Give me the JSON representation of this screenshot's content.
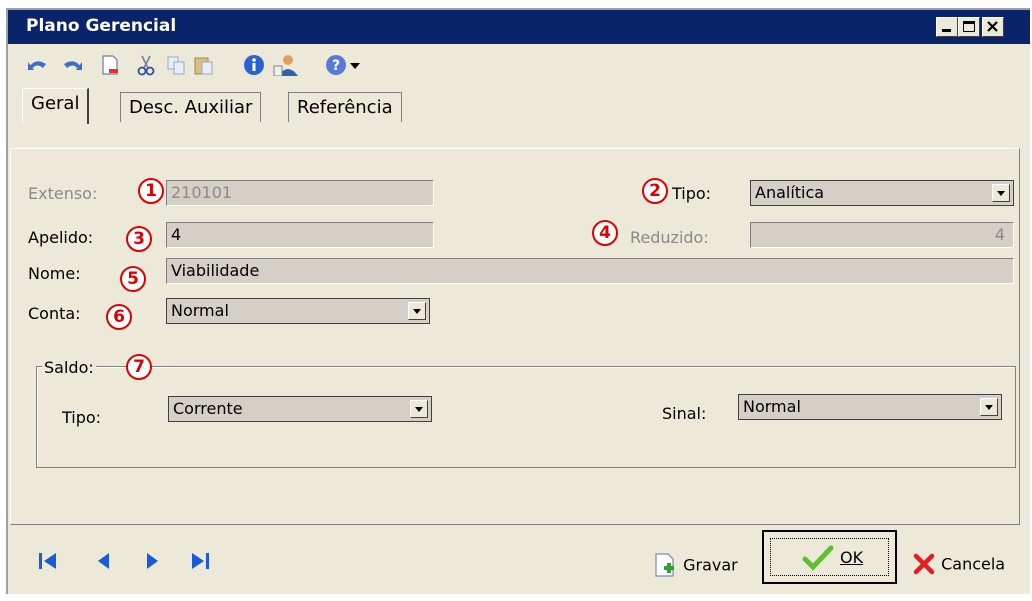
{
  "window": {
    "title": "Plano Gerencial",
    "controls": [
      "minimize-icon",
      "maximize-icon",
      "close-icon"
    ]
  },
  "toolbar": {
    "icons": [
      "undo-icon",
      "redo-icon",
      "new-document-icon",
      "cut-icon",
      "copy-icon",
      "paste-icon",
      "info-icon",
      "user-icon",
      "help-icon",
      "dropdown-arrow-icon"
    ]
  },
  "tabs": [
    {
      "label": "Geral",
      "active": true
    },
    {
      "label": "Desc. Auxiliar",
      "active": false
    },
    {
      "label": "Referência",
      "active": false
    }
  ],
  "form": {
    "extenso": {
      "label": "Extenso:",
      "value": "210101",
      "badge": "1"
    },
    "tipo": {
      "label": "Tipo:",
      "value": "Analítica",
      "badge": "2"
    },
    "apelido": {
      "label": "Apelido:",
      "value": "4",
      "badge": "3"
    },
    "reduzido": {
      "label": "Reduzido:",
      "value": "4",
      "badge": "4"
    },
    "nome": {
      "label": "Nome:",
      "value": "Viabilidade",
      "badge": "5"
    },
    "conta": {
      "label": "Conta:",
      "value": "Normal",
      "badge": "6"
    }
  },
  "saldo": {
    "label": "Saldo:",
    "badge": "7",
    "tipo": {
      "label": "Tipo:",
      "value": "Corrente"
    },
    "sinal": {
      "label": "Sinal:",
      "value": "Normal"
    }
  },
  "footer": {
    "nav_icons": [
      "first-record-icon",
      "previous-record-icon",
      "next-record-icon",
      "last-record-icon"
    ],
    "gravar_label": "Gravar",
    "ok_label": "OK",
    "cancela_label": "Cancela"
  },
  "colors": {
    "titlebar": "#0a246a",
    "badge": "#e00000",
    "window_bg": "#ece9d8",
    "field_bg": "#d4d0c8",
    "nav_blue": "#1a5bd6"
  }
}
